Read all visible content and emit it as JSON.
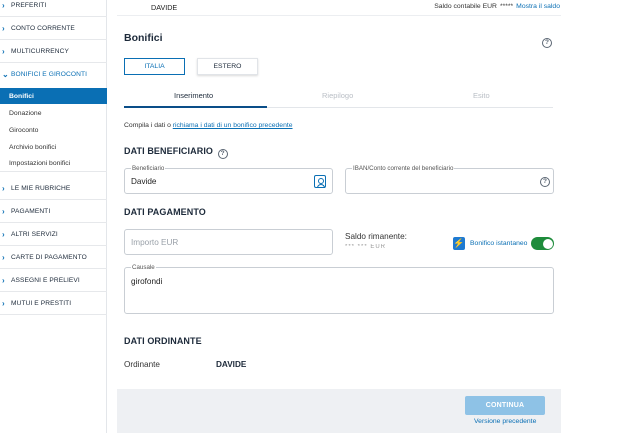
{
  "sidebar": {
    "items": [
      {
        "label": "PREFERITI"
      },
      {
        "label": "CONTO CORRENTE"
      },
      {
        "label": "MULTICURRENCY"
      },
      {
        "label": "BONIFICI E GIROCONTI"
      },
      {
        "label": "LE MIE RUBRICHE"
      },
      {
        "label": "PAGAMENTI"
      },
      {
        "label": "ALTRI SERVIZI"
      },
      {
        "label": "CARTE DI PAGAMENTO"
      },
      {
        "label": "ASSEGNI E PRELIEVI"
      },
      {
        "label": "MUTUI E PRESTITI"
      }
    ],
    "subitems": [
      {
        "label": "Bonifici"
      },
      {
        "label": "Donazione"
      },
      {
        "label": "Giroconto"
      },
      {
        "label": "Archivio bonifici"
      },
      {
        "label": "Impostazioni bonifici"
      }
    ]
  },
  "topbar": {
    "user": "DAVIDE",
    "balance_label": "Saldo contabile EUR",
    "balance_masked": "*****",
    "show_balance": "Mostra il saldo"
  },
  "page": {
    "title": "Bonifici",
    "tab_italia": "ITALIA",
    "tab_estero": "ESTERO",
    "steps": [
      "Inserimento",
      "Riepilogo",
      "Esito"
    ],
    "recall_prefix": "Compila i dati o",
    "recall_link": "richiama i dati di un bonifico precedente"
  },
  "beneficiario": {
    "section_title": "DATI BENEFICIARIO",
    "name_label": "Beneficiario",
    "name_value": "Davide",
    "iban_label": "IBAN/Conto corrente del beneficiario",
    "iban_value": ""
  },
  "pagamento": {
    "section_title": "DATI PAGAMENTO",
    "amount_placeholder": "Importo EUR",
    "saldo_label": "Saldo rimanente:",
    "saldo_value": "*** *** EUR",
    "instant_label": "Bonifico istantaneo",
    "instant_on": true,
    "causale_label": "Causale",
    "causale_value": "girofondi"
  },
  "ordinante": {
    "section_title": "DATI ORDINANTE",
    "label": "Ordinante",
    "value": "DAVIDE"
  },
  "footer": {
    "continue_label": "CONTINUA",
    "prev_label": "Versione precedente"
  },
  "colors": {
    "accent": "#0a6fb4",
    "toggle_on": "#1e8c3b",
    "button_disabled": "#8ec2e6"
  }
}
